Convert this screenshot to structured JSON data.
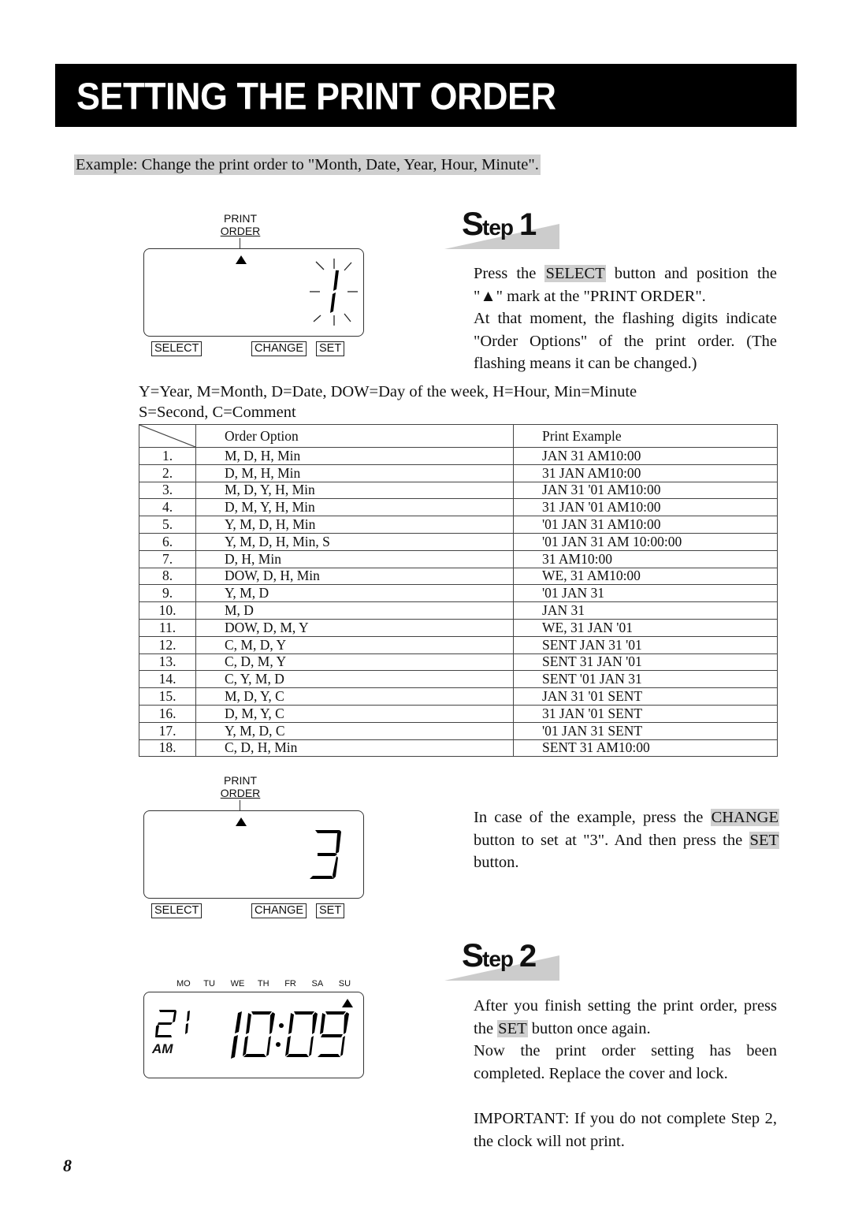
{
  "page": {
    "title": "SETTING THE PRINT ORDER",
    "example": "Example: Change the print order to \"Month, Date, Year, Hour, Minute\".",
    "page_number": "8"
  },
  "panel1": {
    "label_line1": "PRINT",
    "label_line2": "ORDER",
    "display_value": "1",
    "display_state": "flashing",
    "keys": {
      "select": "SELECT",
      "change": "CHANGE",
      "set": "SET"
    }
  },
  "step1": {
    "heading_S": "S",
    "heading_tep": "tep",
    "heading_num": "1",
    "p1_before": "Press the ",
    "p1_button": "SELECT",
    "p1_after": " button and position the \"▲\" mark at the \"PRINT ORDER\".",
    "p2": "At that moment, the flashing digits indicate \"Order Options\" of the print order. (The flashing means it can be changed.)"
  },
  "legend": {
    "line1": "Y=Year, M=Month, D=Date, DOW=Day of the week, H=Hour, Min=Minute",
    "line2": "S=Second, C=Comment"
  },
  "table": {
    "headers": [
      "",
      "Order Option",
      "Print Example"
    ],
    "rows": [
      [
        "1.",
        "M, D, H, Min",
        "JAN 31 AM10:00"
      ],
      [
        "2.",
        "D, M, H, Min",
        "31 JAN AM10:00"
      ],
      [
        "3.",
        "M, D, Y, H, Min",
        "JAN 31 '01 AM10:00"
      ],
      [
        "4.",
        "D, M, Y, H, Min",
        "31 JAN '01 AM10:00"
      ],
      [
        "5.",
        "Y, M, D, H, Min",
        "'01 JAN 31 AM10:00"
      ],
      [
        "6.",
        "Y, M, D, H, Min, S",
        "'01 JAN 31 AM 10:00:00"
      ],
      [
        "7.",
        "D, H, Min",
        "31 AM10:00"
      ],
      [
        "8.",
        "DOW, D, H, Min",
        "WE, 31 AM10:00"
      ],
      [
        "9.",
        "Y, M, D",
        "'01 JAN 31"
      ],
      [
        "10.",
        "M, D",
        "JAN 31"
      ],
      [
        "11.",
        "DOW, D, M, Y",
        "WE, 31 JAN '01"
      ],
      [
        "12.",
        "C, M, D, Y",
        "SENT JAN 31 '01"
      ],
      [
        "13.",
        "C, D, M, Y",
        "SENT 31 JAN '01"
      ],
      [
        "14.",
        "C, Y, M, D",
        "SENT '01 JAN 31"
      ],
      [
        "15.",
        "M, D, Y, C",
        "JAN 31 '01 SENT"
      ],
      [
        "16.",
        "D, M, Y, C",
        "31 JAN '01 SENT"
      ],
      [
        "17.",
        "Y, M, D, C",
        "'01 JAN 31 SENT"
      ],
      [
        "18.",
        "C, D, H, Min",
        "SENT 31 AM10:00"
      ]
    ]
  },
  "panel2": {
    "label_line1": "PRINT",
    "label_line2": "ORDER",
    "display_value": "3",
    "keys": {
      "select": "SELECT",
      "change": "CHANGE",
      "set": "SET"
    }
  },
  "instruction": {
    "before1": "In case of the example, press the ",
    "button1": "CHANGE",
    "between": " button to set at \"3\". And then press the ",
    "button2": "SET",
    "after": " button."
  },
  "panel3": {
    "days": [
      "MO",
      "TU",
      "WE",
      "TH",
      "FR",
      "SA",
      "SU"
    ],
    "date_display": "21",
    "meridiem": "AM",
    "time_display": "10:09",
    "marker_day": "SU"
  },
  "step2": {
    "heading_S": "S",
    "heading_tep": "tep",
    "heading_num": "2",
    "p1_before": "After you finish setting the print order, press the ",
    "p1_button": "SET",
    "p1_after": " button once again.",
    "p2": "Now the print order setting has been completed. Replace the cover and lock.",
    "important": "IMPORTANT: If you do not complete Step 2, the clock will not print."
  },
  "colors": {
    "title_bg": "#000000",
    "highlight": "#cfcfcf",
    "step_wedge": "#cccccc"
  }
}
